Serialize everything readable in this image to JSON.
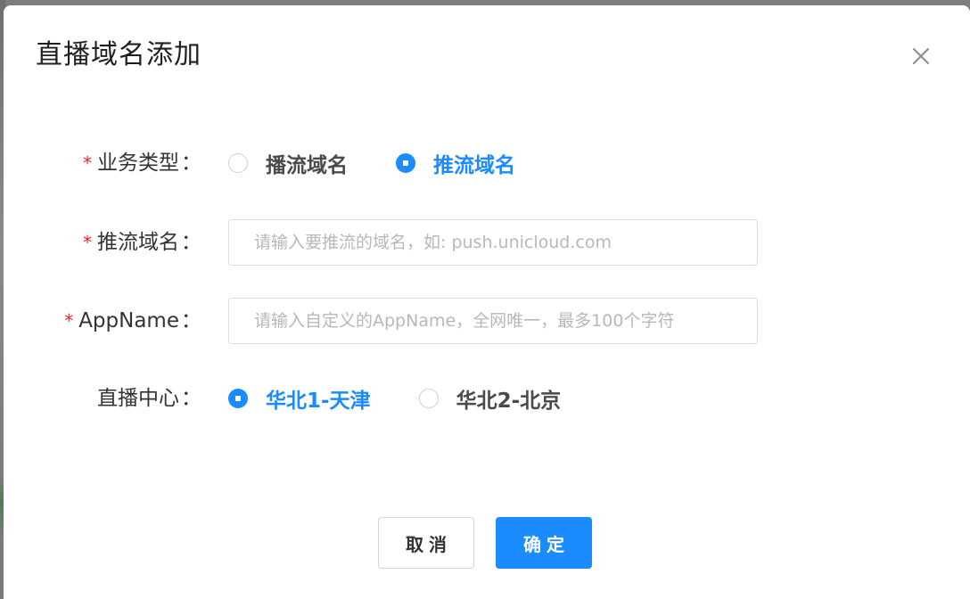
{
  "dialog": {
    "title": "直播域名添加"
  },
  "form": {
    "business_type": {
      "label": "业务类型",
      "options": [
        {
          "label": "播流域名",
          "checked": false
        },
        {
          "label": "推流域名",
          "checked": true
        }
      ]
    },
    "push_domain": {
      "label": "推流域名",
      "value": "",
      "placeholder": "请输入要推流的域名，如: push.unicloud.com"
    },
    "app_name": {
      "label": "AppName",
      "value": "",
      "placeholder": "请输入自定义的AppName，全网唯一，最多100个字符"
    },
    "live_center": {
      "label": "直播中心",
      "options": [
        {
          "label": "华北1-天津",
          "checked": true
        },
        {
          "label": "华北2-北京",
          "checked": false
        }
      ]
    },
    "required_mark": "*",
    "colon": "："
  },
  "footer": {
    "cancel_label": "取消",
    "ok_label": "确定"
  },
  "colors": {
    "primary": "#1a8cff",
    "required": "#f5222d"
  },
  "icons": {
    "close": "close-icon"
  }
}
